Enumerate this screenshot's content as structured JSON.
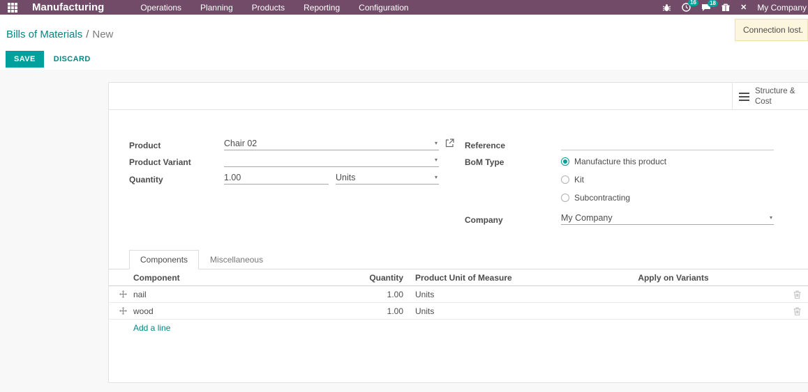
{
  "navbar": {
    "app_title": "Manufacturing",
    "menus": [
      "Operations",
      "Planning",
      "Products",
      "Reporting",
      "Configuration"
    ],
    "badges": {
      "activities": "16",
      "messages": "18"
    },
    "company": "My Company"
  },
  "notification": {
    "text": "Connection lost."
  },
  "breadcrumb": {
    "parent": "Bills of Materials",
    "separator": "/",
    "current": "New"
  },
  "actions": {
    "save": "SAVE",
    "discard": "DISCARD"
  },
  "sheet": {
    "smart_button": {
      "label": "Structure & Cost"
    },
    "fields": {
      "product": {
        "label": "Product",
        "value": "Chair 02"
      },
      "product_variant": {
        "label": "Product Variant",
        "value": ""
      },
      "quantity": {
        "label": "Quantity",
        "value": "1.00",
        "uom": "Units"
      },
      "reference": {
        "label": "Reference",
        "value": ""
      },
      "bom_type": {
        "label": "BoM Type",
        "options": [
          {
            "label": "Manufacture this product",
            "selected": true
          },
          {
            "label": "Kit",
            "selected": false
          },
          {
            "label": "Subcontracting",
            "selected": false
          }
        ]
      },
      "company": {
        "label": "Company",
        "value": "My Company"
      }
    },
    "tabs": [
      {
        "label": "Components",
        "active": true
      },
      {
        "label": "Miscellaneous",
        "active": false
      }
    ],
    "components_table": {
      "headers": [
        "Component",
        "Quantity",
        "Product Unit of Measure",
        "Apply on Variants"
      ],
      "rows": [
        {
          "component": "nail",
          "quantity": "1.00",
          "uom": "Units"
        },
        {
          "component": "wood",
          "quantity": "1.00",
          "uom": "Units"
        }
      ],
      "add_line": "Add a line"
    }
  },
  "colors": {
    "accent": "#00A09D",
    "link": "#008784",
    "navbar": "#714B67"
  }
}
